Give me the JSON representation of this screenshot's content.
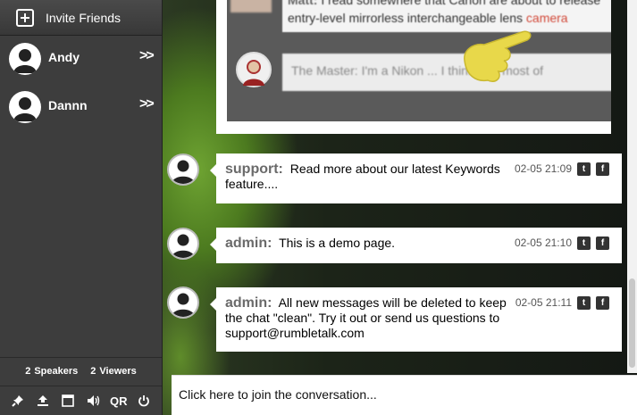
{
  "sidebar": {
    "invite_label": "Invite Friends",
    "users": [
      {
        "name": "Andy",
        "chevron": ">>"
      },
      {
        "name": "Dannn",
        "chevron": ">>"
      }
    ],
    "counts": {
      "speakers_count": "2",
      "speakers_label": "Speakers",
      "viewers_count": "2",
      "viewers_label": "Viewers"
    },
    "toolbar": {
      "pin": "pin-icon",
      "upload": "upload-icon",
      "window": "window-icon",
      "sound": "sound-icon",
      "qr_label": "QR",
      "power": "power-icon"
    }
  },
  "embedded_image": {
    "msg1_author": "Matt:",
    "msg1_text": " I read somewhere that Canon are about to release",
    "msg1_text2": "entry-level mirrorless interchangeable lens ",
    "msg1_link": "camera",
    "msg2_text": "The Master: I'm a Nikon ... I think that most of"
  },
  "messages": [
    {
      "author": "support:",
      "text": "Read more about our latest Keywords feature....",
      "time": "02-05 21:09",
      "twitter": "t",
      "facebook": "f"
    },
    {
      "author": "admin:",
      "text": "This is a demo page.",
      "time": "02-05 21:10",
      "twitter": "t",
      "facebook": "f"
    },
    {
      "author": "admin:",
      "text": "All new messages will be deleted to keep the chat \"clean\". Try it out or send us questions to support@rumbletalk.com",
      "time": "02-05 21:11",
      "twitter": "t",
      "facebook": "f"
    }
  ],
  "join": {
    "placeholder": "Click here to join the conversation..."
  },
  "colors": {
    "sidebar_bg": "#3d3d3d",
    "author_gray": "#6a6a6a",
    "link_red": "#d24a3a"
  }
}
